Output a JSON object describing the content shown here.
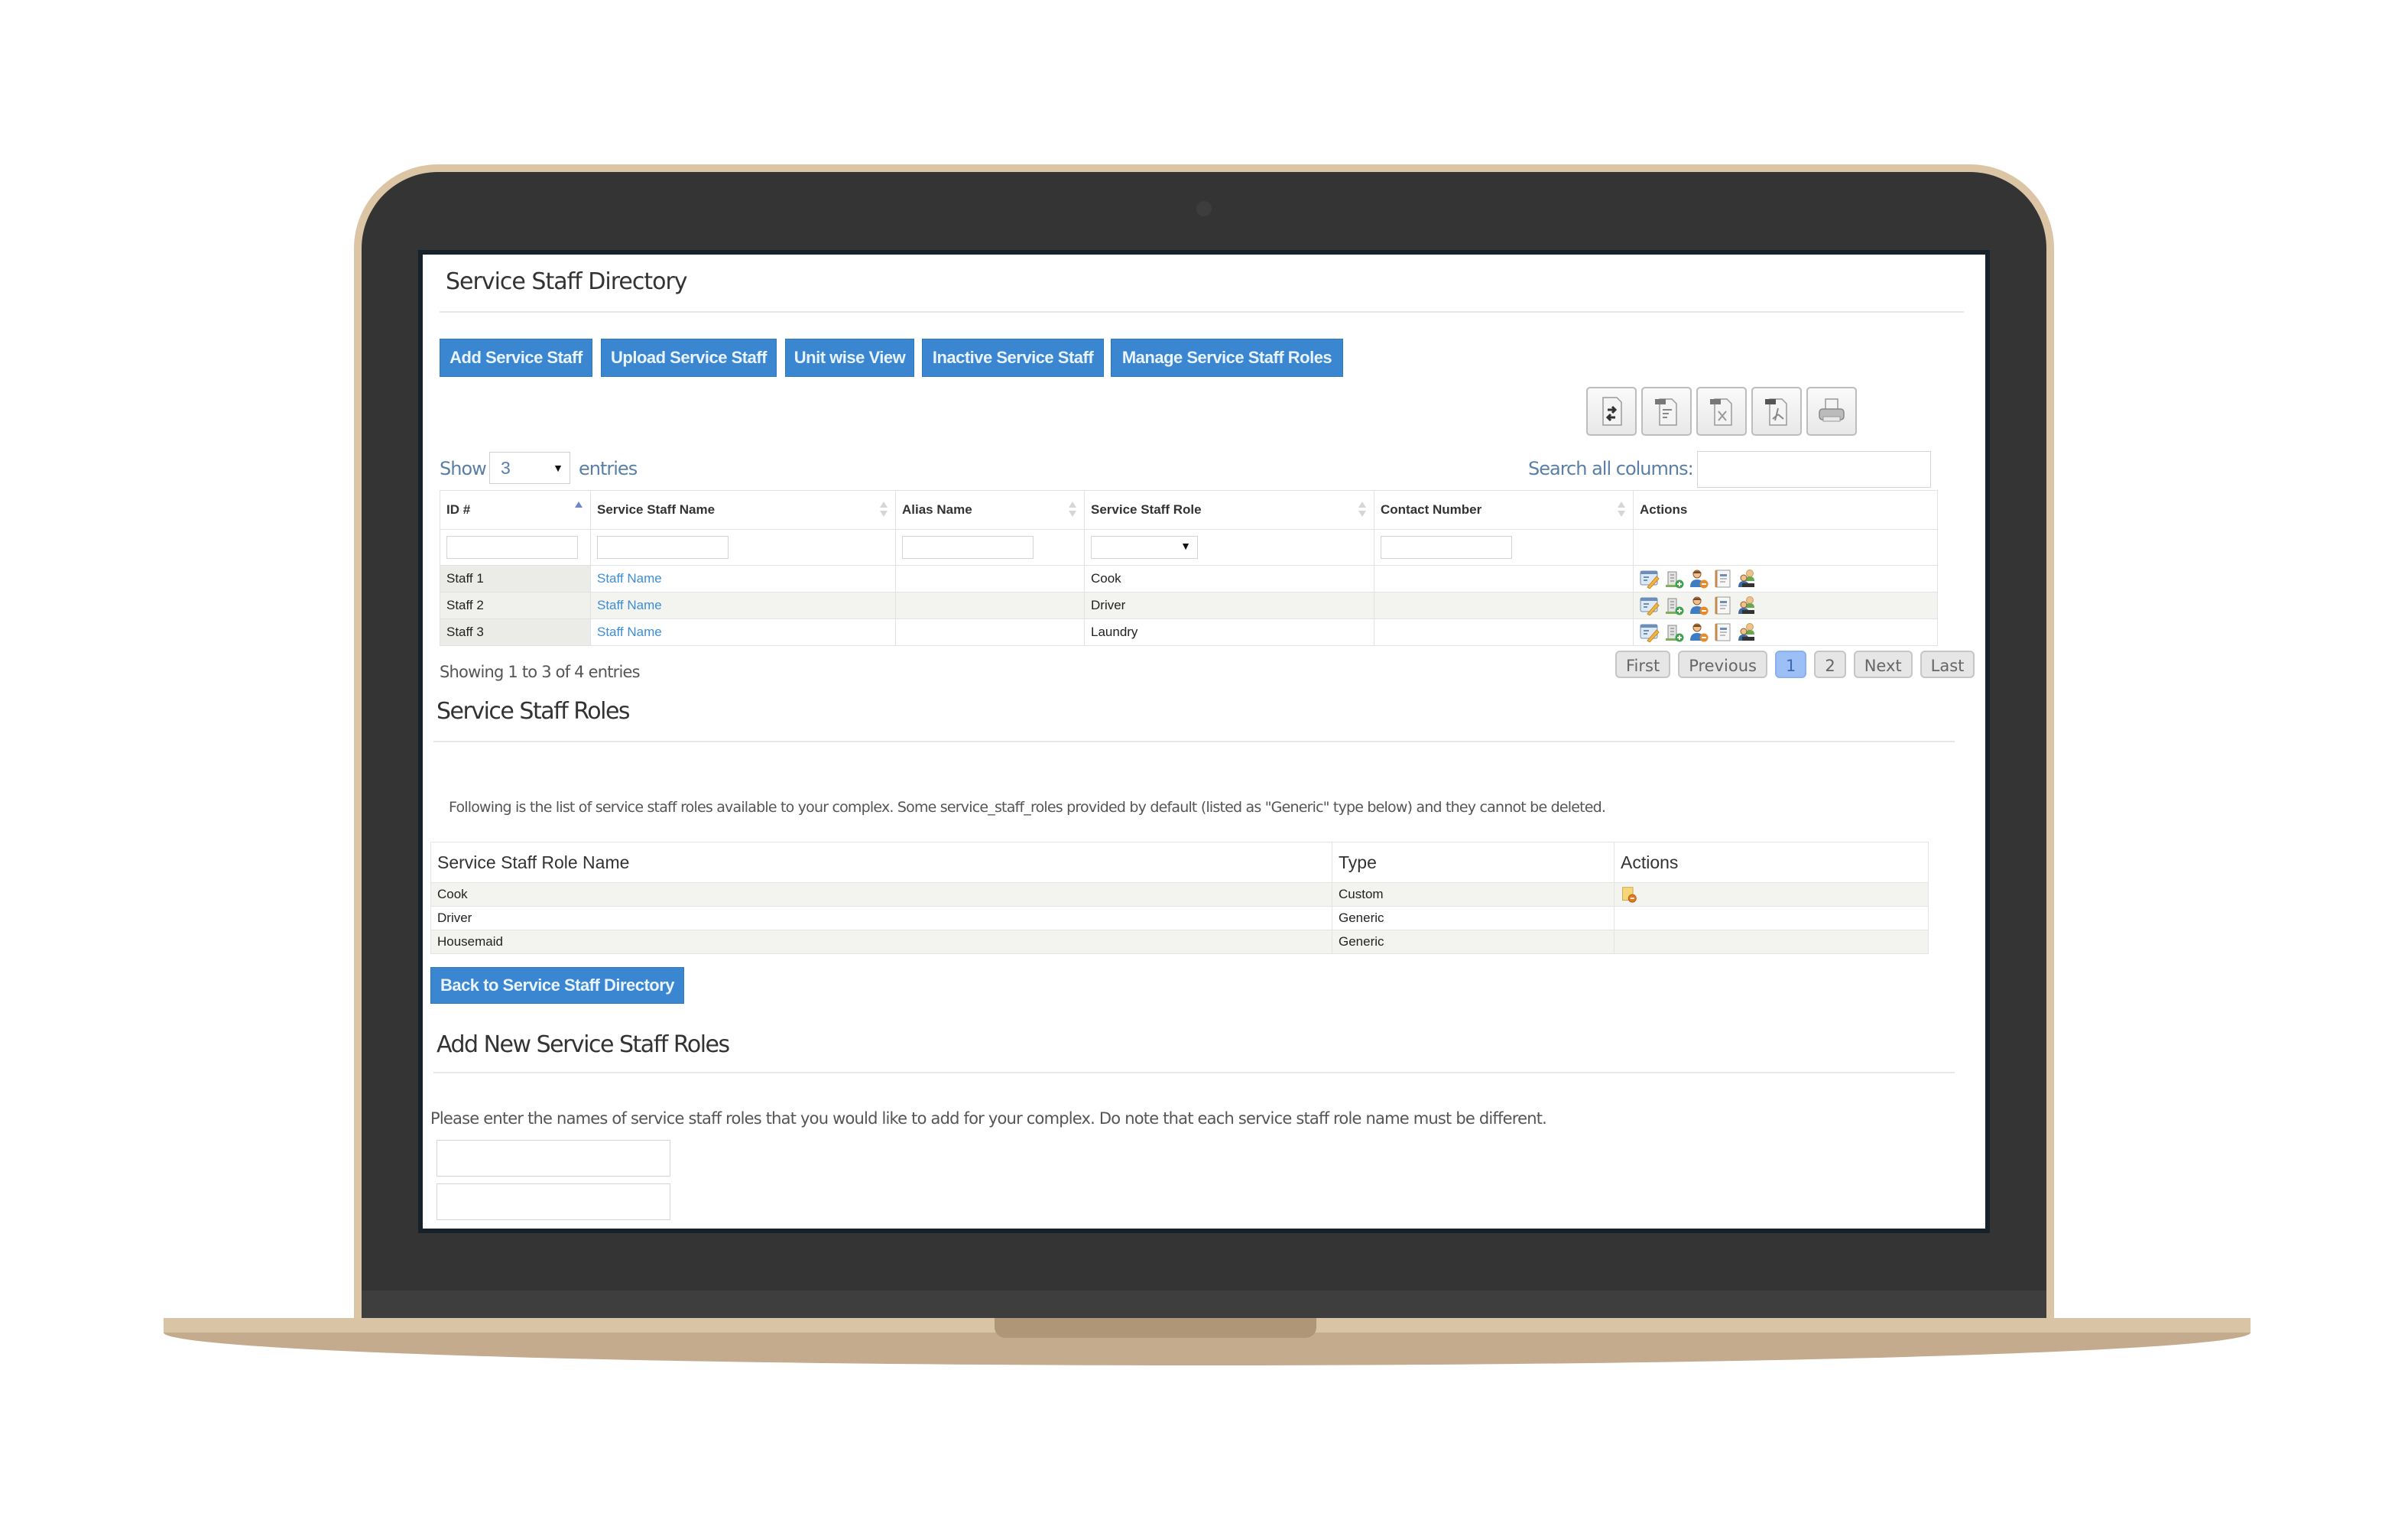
{
  "directory": {
    "title": "Service Staff Directory",
    "buttons": [
      {
        "label": "Add Service Staff"
      },
      {
        "label": "Upload Service Staff"
      },
      {
        "label": "Unit wise View"
      },
      {
        "label": "Inactive Service Staff"
      },
      {
        "label": "Manage Service Staff Roles"
      }
    ],
    "export_tools": [
      "copy-icon",
      "csv-icon",
      "xls-icon",
      "pdf-icon",
      "print-icon"
    ],
    "show_label": "Show",
    "page_length": "3",
    "entries_label": "entries",
    "search_label": "Search all columns:",
    "search_value": "",
    "columns": [
      "ID #",
      "Service Staff Name",
      "Alias Name",
      "Service Staff Role",
      "Contact Number",
      "Actions"
    ],
    "sorted_column": "ID #",
    "sort_direction": "ascending",
    "rows": [
      {
        "id": "Staff 1",
        "name": "Staff Name",
        "alias": "",
        "role": "Cook",
        "contact": ""
      },
      {
        "id": "Staff 2",
        "name": "Staff Name",
        "alias": "",
        "role": "Driver",
        "contact": ""
      },
      {
        "id": "Staff 3",
        "name": "Staff Name",
        "alias": "",
        "role": "Laundry",
        "contact": ""
      }
    ],
    "row_actions": [
      "edit-icon",
      "assign-unit-icon",
      "deactivate-user-icon",
      "notes-icon",
      "family-icon"
    ],
    "info": "Showing 1 to 3 of 4 entries",
    "pagination": {
      "first": "First",
      "previous": "Previous",
      "pages": [
        "1",
        "2"
      ],
      "current": "1",
      "next": "Next",
      "last": "Last"
    }
  },
  "roles": {
    "title": "Service Staff Roles",
    "description": "Following is the list of service staff roles available to your complex. Some service_staff_roles provided by default (listed as \"Generic\" type below) and they cannot be deleted.",
    "columns": [
      "Service Staff Role Name",
      "Type",
      "Actions"
    ],
    "rows": [
      {
        "name": "Cook",
        "type": "Custom",
        "action": "delete-icon"
      },
      {
        "name": "Driver",
        "type": "Generic",
        "action": ""
      },
      {
        "name": "Housemaid",
        "type": "Generic",
        "action": ""
      }
    ],
    "back_button": "Back to Service Staff Directory"
  },
  "add_roles": {
    "title": "Add New Service Staff Roles",
    "description": "Please enter the names of service staff roles that you would like to add for your complex. Do note that each service staff role name must be different.",
    "inputs": [
      "",
      ""
    ]
  },
  "colors": {
    "button": "#3a86d0",
    "link": "#3d8ed6",
    "label": "#5a7fa6",
    "page_active": "#9cbff5",
    "laptop_frame": "#dcc5a5",
    "bezel": "#343434"
  }
}
